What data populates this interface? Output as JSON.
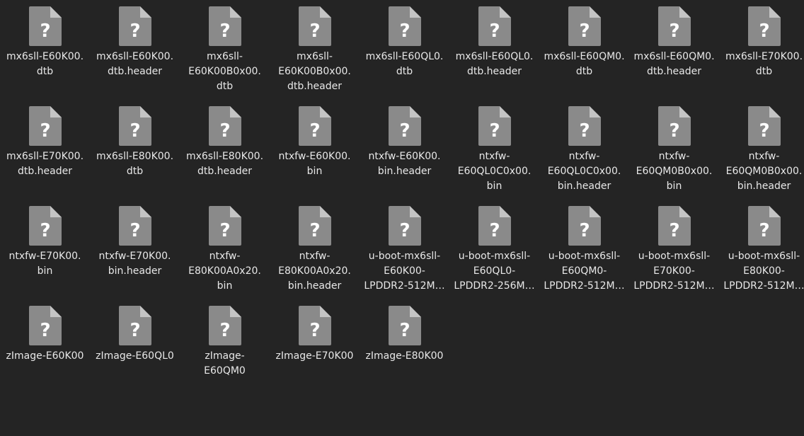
{
  "icon": "unknown-file-icon",
  "colors": {
    "background": "#242424",
    "icon_body": "#8a8a8a",
    "icon_fold": "#c4c4c4",
    "icon_glyph": "#ffffff",
    "label": "#e8e8e8"
  },
  "files": [
    {
      "label": "mx6sll-E60K00.\ndtb"
    },
    {
      "label": "mx6sll-E60K00.\ndtb.header"
    },
    {
      "label": "mx6sll-\nE60K00B0x00.\ndtb"
    },
    {
      "label": "mx6sll-\nE60K00B0x00.\ndtb.header"
    },
    {
      "label": "mx6sll-E60QL0.\ndtb"
    },
    {
      "label": "mx6sll-E60QL0.\ndtb.header"
    },
    {
      "label": "mx6sll-E60QM0.\ndtb"
    },
    {
      "label": "mx6sll-E60QM0.\ndtb.header"
    },
    {
      "label": "mx6sll-E70K00.\ndtb"
    },
    {
      "label": "mx6sll-E70K00.\ndtb.header"
    },
    {
      "label": "mx6sll-E80K00.\ndtb"
    },
    {
      "label": "mx6sll-E80K00.\ndtb.header"
    },
    {
      "label": "ntxfw-E60K00.\nbin"
    },
    {
      "label": "ntxfw-E60K00.\nbin.header"
    },
    {
      "label": "ntxfw-\nE60QL0C0x00.\nbin"
    },
    {
      "label": "ntxfw-\nE60QL0C0x00.\nbin.header"
    },
    {
      "label": "ntxfw-\nE60QM0B0x00.\nbin"
    },
    {
      "label": "ntxfw-\nE60QM0B0x00.\nbin.header"
    },
    {
      "label": "ntxfw-E70K00.\nbin"
    },
    {
      "label": "ntxfw-E70K00.\nbin.header"
    },
    {
      "label": "ntxfw-\nE80K00A0x20.\nbin"
    },
    {
      "label": "ntxfw-\nE80K00A0x20.\nbin.header"
    },
    {
      "label": "u-boot-mx6sll-\nE60K00-\nLPDDR2-512M…"
    },
    {
      "label": "u-boot-mx6sll-\nE60QL0-\nLPDDR2-256M…"
    },
    {
      "label": "u-boot-mx6sll-\nE60QM0-\nLPDDR2-512M…"
    },
    {
      "label": "u-boot-mx6sll-\nE70K00-\nLPDDR2-512M…"
    },
    {
      "label": "u-boot-mx6sll-\nE80K00-\nLPDDR2-512M…"
    },
    {
      "label": "zImage-E60K00"
    },
    {
      "label": "zImage-E60QL0"
    },
    {
      "label": "zImage-\nE60QM0"
    },
    {
      "label": "zImage-E70K00"
    },
    {
      "label": "zImage-E80K00"
    }
  ]
}
